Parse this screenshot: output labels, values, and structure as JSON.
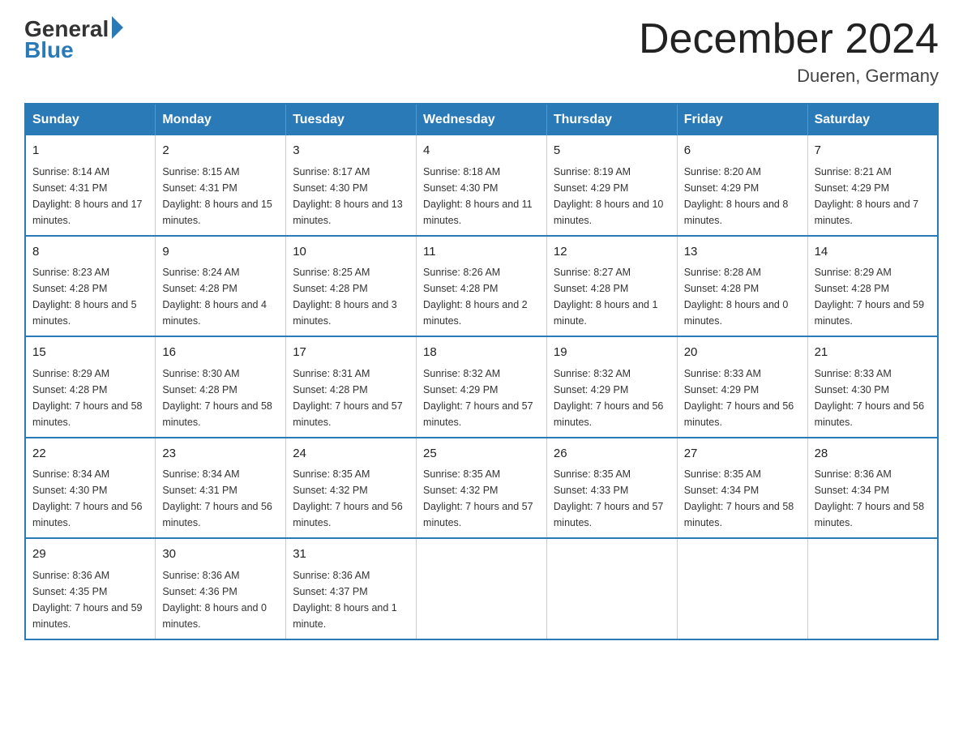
{
  "header": {
    "logo_general": "General",
    "logo_blue": "Blue",
    "month_title": "December 2024",
    "location": "Dueren, Germany"
  },
  "days_of_week": [
    "Sunday",
    "Monday",
    "Tuesday",
    "Wednesday",
    "Thursday",
    "Friday",
    "Saturday"
  ],
  "weeks": [
    [
      {
        "day": "1",
        "sunrise": "8:14 AM",
        "sunset": "4:31 PM",
        "daylight": "8 hours and 17 minutes."
      },
      {
        "day": "2",
        "sunrise": "8:15 AM",
        "sunset": "4:31 PM",
        "daylight": "8 hours and 15 minutes."
      },
      {
        "day": "3",
        "sunrise": "8:17 AM",
        "sunset": "4:30 PM",
        "daylight": "8 hours and 13 minutes."
      },
      {
        "day": "4",
        "sunrise": "8:18 AM",
        "sunset": "4:30 PM",
        "daylight": "8 hours and 11 minutes."
      },
      {
        "day": "5",
        "sunrise": "8:19 AM",
        "sunset": "4:29 PM",
        "daylight": "8 hours and 10 minutes."
      },
      {
        "day": "6",
        "sunrise": "8:20 AM",
        "sunset": "4:29 PM",
        "daylight": "8 hours and 8 minutes."
      },
      {
        "day": "7",
        "sunrise": "8:21 AM",
        "sunset": "4:29 PM",
        "daylight": "8 hours and 7 minutes."
      }
    ],
    [
      {
        "day": "8",
        "sunrise": "8:23 AM",
        "sunset": "4:28 PM",
        "daylight": "8 hours and 5 minutes."
      },
      {
        "day": "9",
        "sunrise": "8:24 AM",
        "sunset": "4:28 PM",
        "daylight": "8 hours and 4 minutes."
      },
      {
        "day": "10",
        "sunrise": "8:25 AM",
        "sunset": "4:28 PM",
        "daylight": "8 hours and 3 minutes."
      },
      {
        "day": "11",
        "sunrise": "8:26 AM",
        "sunset": "4:28 PM",
        "daylight": "8 hours and 2 minutes."
      },
      {
        "day": "12",
        "sunrise": "8:27 AM",
        "sunset": "4:28 PM",
        "daylight": "8 hours and 1 minute."
      },
      {
        "day": "13",
        "sunrise": "8:28 AM",
        "sunset": "4:28 PM",
        "daylight": "8 hours and 0 minutes."
      },
      {
        "day": "14",
        "sunrise": "8:29 AM",
        "sunset": "4:28 PM",
        "daylight": "7 hours and 59 minutes."
      }
    ],
    [
      {
        "day": "15",
        "sunrise": "8:29 AM",
        "sunset": "4:28 PM",
        "daylight": "7 hours and 58 minutes."
      },
      {
        "day": "16",
        "sunrise": "8:30 AM",
        "sunset": "4:28 PM",
        "daylight": "7 hours and 58 minutes."
      },
      {
        "day": "17",
        "sunrise": "8:31 AM",
        "sunset": "4:28 PM",
        "daylight": "7 hours and 57 minutes."
      },
      {
        "day": "18",
        "sunrise": "8:32 AM",
        "sunset": "4:29 PM",
        "daylight": "7 hours and 57 minutes."
      },
      {
        "day": "19",
        "sunrise": "8:32 AM",
        "sunset": "4:29 PM",
        "daylight": "7 hours and 56 minutes."
      },
      {
        "day": "20",
        "sunrise": "8:33 AM",
        "sunset": "4:29 PM",
        "daylight": "7 hours and 56 minutes."
      },
      {
        "day": "21",
        "sunrise": "8:33 AM",
        "sunset": "4:30 PM",
        "daylight": "7 hours and 56 minutes."
      }
    ],
    [
      {
        "day": "22",
        "sunrise": "8:34 AM",
        "sunset": "4:30 PM",
        "daylight": "7 hours and 56 minutes."
      },
      {
        "day": "23",
        "sunrise": "8:34 AM",
        "sunset": "4:31 PM",
        "daylight": "7 hours and 56 minutes."
      },
      {
        "day": "24",
        "sunrise": "8:35 AM",
        "sunset": "4:32 PM",
        "daylight": "7 hours and 56 minutes."
      },
      {
        "day": "25",
        "sunrise": "8:35 AM",
        "sunset": "4:32 PM",
        "daylight": "7 hours and 57 minutes."
      },
      {
        "day": "26",
        "sunrise": "8:35 AM",
        "sunset": "4:33 PM",
        "daylight": "7 hours and 57 minutes."
      },
      {
        "day": "27",
        "sunrise": "8:35 AM",
        "sunset": "4:34 PM",
        "daylight": "7 hours and 58 minutes."
      },
      {
        "day": "28",
        "sunrise": "8:36 AM",
        "sunset": "4:34 PM",
        "daylight": "7 hours and 58 minutes."
      }
    ],
    [
      {
        "day": "29",
        "sunrise": "8:36 AM",
        "sunset": "4:35 PM",
        "daylight": "7 hours and 59 minutes."
      },
      {
        "day": "30",
        "sunrise": "8:36 AM",
        "sunset": "4:36 PM",
        "daylight": "8 hours and 0 minutes."
      },
      {
        "day": "31",
        "sunrise": "8:36 AM",
        "sunset": "4:37 PM",
        "daylight": "8 hours and 1 minute."
      },
      null,
      null,
      null,
      null
    ]
  ]
}
